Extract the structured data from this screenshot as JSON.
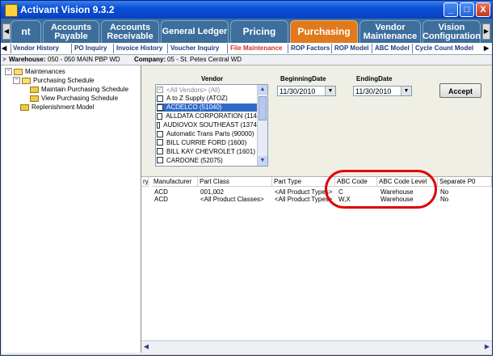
{
  "window": {
    "title": "Activant Vision 9.3.2",
    "min": "_",
    "max": "□",
    "close": "X"
  },
  "tabs": [
    {
      "label": "nt"
    },
    {
      "label": "Accounts Payable"
    },
    {
      "label": "Accounts Receivable"
    },
    {
      "label": "General Ledger"
    },
    {
      "label": "Pricing"
    },
    {
      "label": "Purchasing",
      "active": true
    },
    {
      "label": "Vendor Maintenance"
    },
    {
      "label": "Vision Configuration"
    }
  ],
  "subnav": {
    "items": [
      "Vendor History",
      "PO Inquiry",
      "Invoice History",
      "Voucher Inquiry",
      "File Maintenance",
      "ROP Factors",
      "ROP Model",
      "ABC Model",
      "Cycle Count Model"
    ],
    "active": "File Maintenance"
  },
  "context": {
    "warehouse_label": "Warehouse:",
    "warehouse_value": "050 - 050 MAIN PBP WD",
    "company_label": "Company:",
    "company_value": "05 - St. Petes Central WD"
  },
  "tree": {
    "root": "Maintenances",
    "items": [
      "Purchasing Schedule",
      "Maintain Purchasing Schedule",
      "View Purchasing Schedule",
      "Replenishment Model"
    ]
  },
  "vendor": {
    "label": "Vendor",
    "items": [
      {
        "text": "<All Vendors> (All)",
        "checked": true,
        "dim": true
      },
      {
        "text": "A to Z Supply (ATOZ)",
        "checked": false
      },
      {
        "text": "ACDELCO (51040)",
        "checked": true,
        "selected": true
      },
      {
        "text": "ALLDATA CORPORATION (114",
        "checked": false
      },
      {
        "text": "AUDIOVOX SOUTHEAST (1374",
        "checked": false
      },
      {
        "text": "Automatic Trans Parts (90000)",
        "checked": false
      },
      {
        "text": "BILL CURRIE FORD (1600)",
        "checked": false
      },
      {
        "text": "BILL KAY CHEVROLET (1601)",
        "checked": false
      },
      {
        "text": "CARDONE (52075)",
        "checked": false
      }
    ]
  },
  "dates": {
    "begin_label": "BeginningDate",
    "begin_value": "11/30/2010",
    "end_label": "EndingDate",
    "end_value": "11/30/2010"
  },
  "accept_label": "Accept",
  "grid": {
    "headers": [
      "ry",
      "Manufacturer",
      "Part Class",
      "Part Type",
      "ABC Code",
      "ABC Code Level",
      "Separate P0"
    ],
    "rows": [
      [
        "",
        "ACD",
        "001,002",
        "<All Product Types>",
        "C",
        "Warehouse",
        "No"
      ],
      [
        "",
        "ACD",
        "<All Product Classes>",
        "<All Product Types>",
        "W,X",
        "Warehouse",
        "No"
      ]
    ]
  },
  "colors": {
    "active_tab": "#e07a1c",
    "tab": "#3d6e9c",
    "highlight_oval": "#e00000",
    "titlebar": "#0a4fd6"
  }
}
